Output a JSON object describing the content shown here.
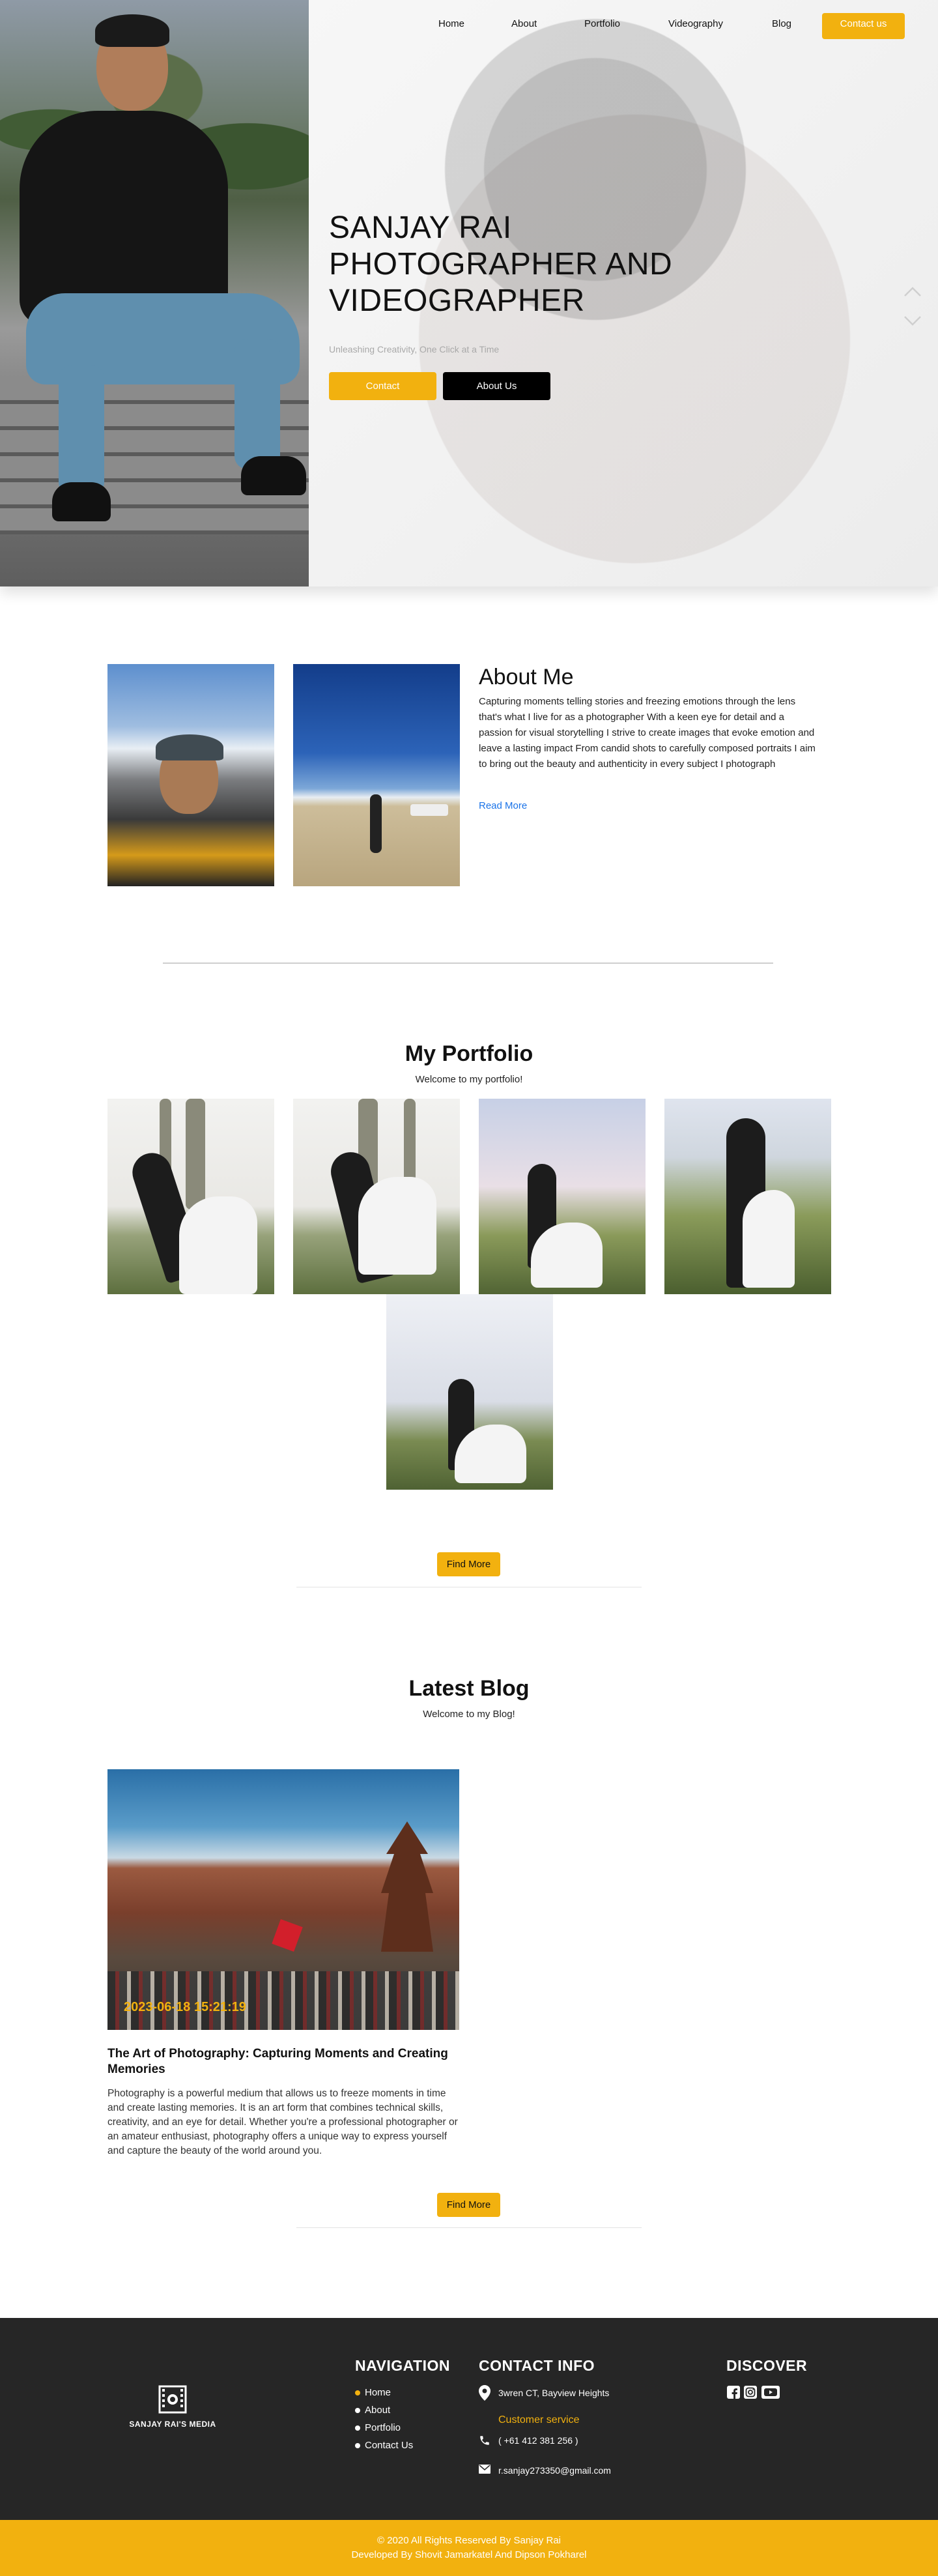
{
  "nav": {
    "home": "Home",
    "about": "About",
    "portfolio": "Portfolio",
    "videography": "Videography",
    "blog": "Blog",
    "contact": "Contact us"
  },
  "hero": {
    "title_line1": "SANJAY RAI",
    "title_line2": "PHOTOGRAPHER AND",
    "title_line3": "VIDEOGRAPHER",
    "subtitle": "Unleashing Creativity, One Click at a Time",
    "contact_button": "Contact",
    "about_button": "About Us"
  },
  "about": {
    "title": "About Me",
    "text": "Capturing moments telling stories and freezing emotions through the lens that's what I live for as a photographer With a keen eye for detail and a passion for visual storytelling I strive to create images that evoke emotion and leave a lasting impact From candid shots to carefully composed portraits I aim to bring out the beauty and authenticity in every subject I photograph",
    "read_more": "Read More"
  },
  "portfolio": {
    "title": "My Portfolio",
    "subtitle": "Welcome to my portfolio!",
    "find_more": "Find More"
  },
  "blog": {
    "title": "Latest Blog",
    "subtitle": "Welcome to my Blog!",
    "post": {
      "date": "2023-06-18 15:21:19",
      "title": "The Art of Photography: Capturing Moments and Creating Memories",
      "excerpt": "Photography is a powerful medium that allows us to freeze moments in time and create lasting memories. It is an art form that combines technical skills, creativity, and an eye for detail. Whether you're a professional photographer or an amateur enthusiast, photography offers a unique way to express yourself and capture the beauty of the world around you."
    },
    "find_more": "Find More"
  },
  "footer": {
    "logo_text": "SANJAY RAI'S MEDIA",
    "navigation_title": "NAVIGATION",
    "nav_items": [
      "Home",
      "About",
      "Portfolio",
      "Contact Us"
    ],
    "contact_title": "CONTACT INFO",
    "address": "3wren CT, Bayview Heights",
    "customer_service": "Customer service",
    "phone": "( +61 412 381 256 )",
    "email": "r.sanjay273350@gmail.com",
    "discover_title": "DISCOVER",
    "social_icons": [
      "facebook-icon",
      "instagram-icon",
      "youtube-icon"
    ],
    "copyright": "© 2020 All Rights Reserved By Sanjay Rai",
    "developers": "Developed By Shovit Jamarkatel And Dipson Pokharel"
  },
  "colors": {
    "accent": "#f2b10f",
    "dark": "#262626",
    "link": "#1a73e8"
  }
}
